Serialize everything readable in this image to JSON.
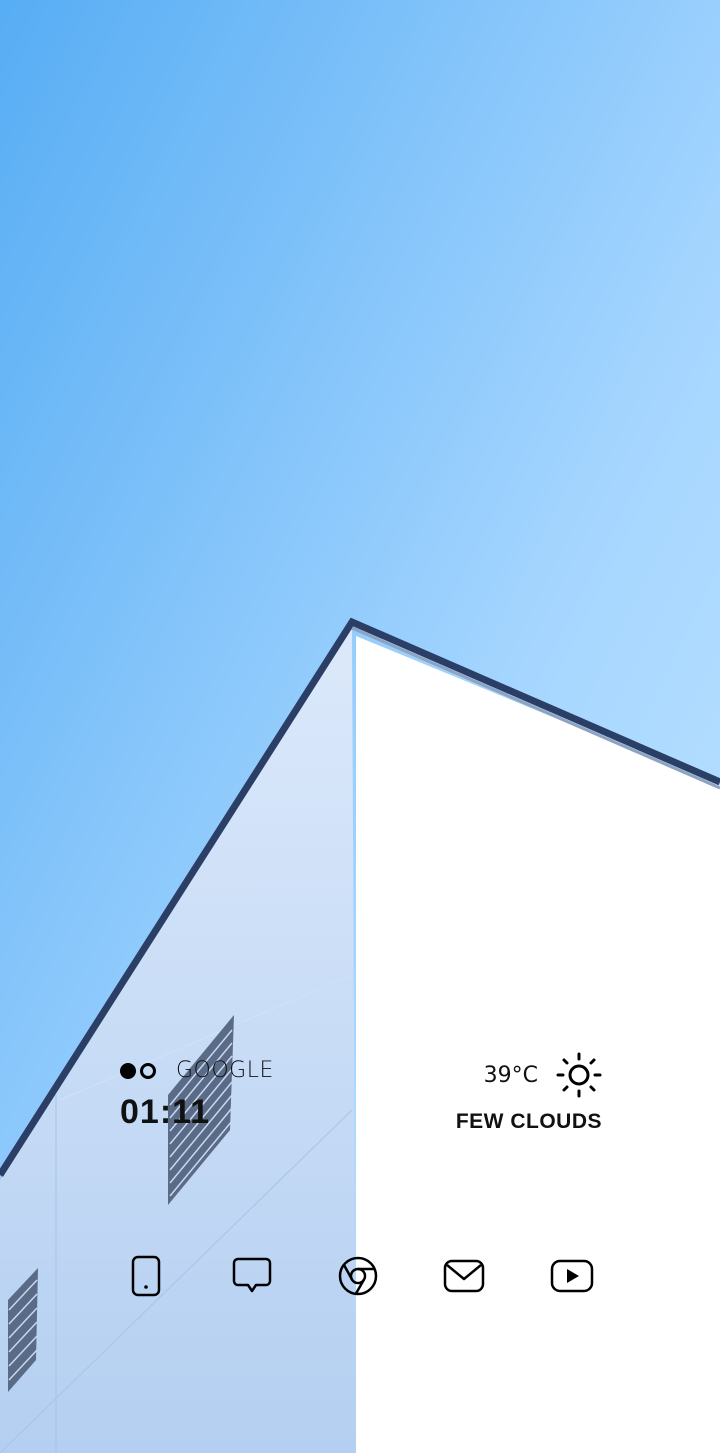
{
  "widgets": {
    "account_label": "GOOGLE",
    "clock_time": "01:11",
    "temperature": "39°C",
    "weather_condition": "FEW CLOUDS",
    "weather_icon": "sun-icon"
  },
  "dock": {
    "apps": [
      {
        "icon": "phone-icon"
      },
      {
        "icon": "message-icon"
      },
      {
        "icon": "chrome-icon"
      },
      {
        "icon": "mail-icon"
      },
      {
        "icon": "youtube-icon"
      }
    ]
  },
  "colors": {
    "sky_top": "#5fb4f5",
    "sky_bottom": "#b9e1ff",
    "wall_shade": "#c7dcf5",
    "wall_white": "#ffffff",
    "text": "#111111"
  }
}
